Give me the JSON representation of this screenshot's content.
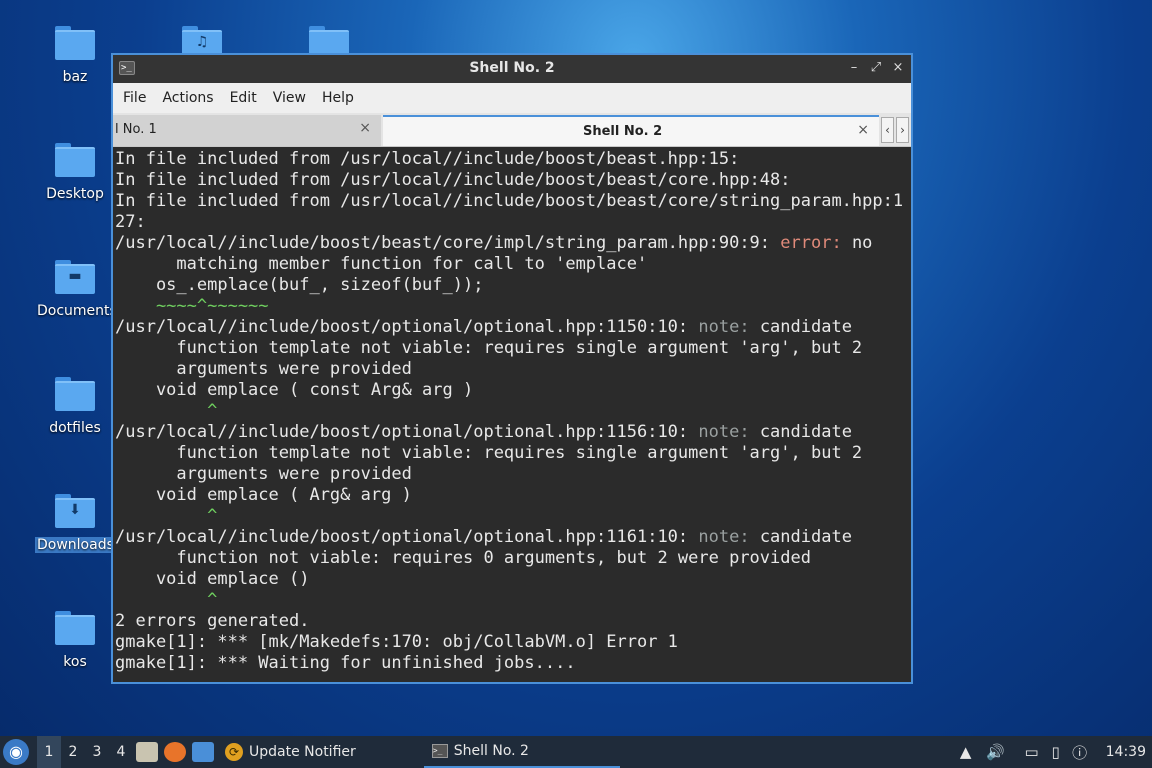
{
  "desktop": {
    "icons": [
      {
        "label": "baz"
      },
      {
        "label": "Desktop"
      },
      {
        "label": "Documents"
      },
      {
        "label": "dotfiles"
      },
      {
        "label": "Downloads"
      },
      {
        "label": "kos"
      }
    ]
  },
  "window": {
    "title": "Shell No. 2",
    "menu": [
      "File",
      "Actions",
      "Edit",
      "View",
      "Help"
    ],
    "tabs": [
      {
        "label": "l No. 1",
        "close": "×"
      },
      {
        "label": "Shell No. 2",
        "close": "×"
      }
    ],
    "controls": {
      "minimize": "–",
      "maximize": "⤢",
      "close": "×"
    },
    "terminal_lines": [
      "In file included from /usr/local//include/boost/beast.hpp:15:",
      "In file included from /usr/local//include/boost/beast/core.hpp:48:",
      "In file included from /usr/local//include/boost/beast/core/string_param.hpp:1",
      "27:",
      "/usr/local//include/boost/beast/core/impl/string_param.hpp:90:9: ",
      "error:",
      " no",
      "      matching member function for call to 'emplace'",
      "    os_.emplace(buf_, sizeof(buf_));",
      "    ~~~~^~~~~~~",
      "/usr/local//include/boost/optional/optional.hpp:1150:10: ",
      "note:",
      " candidate",
      "      function template not viable: requires single argument 'arg', but 2",
      "      arguments were provided",
      "    void emplace ( const Arg& arg )",
      "         ^",
      "/usr/local//include/boost/optional/optional.hpp:1156:10: ",
      "note:",
      " candidate",
      "      function template not viable: requires single argument 'arg', but 2",
      "      arguments were provided",
      "    void emplace ( Arg& arg )",
      "         ^",
      "/usr/local//include/boost/optional/optional.hpp:1161:10: ",
      "note:",
      " candidate",
      "      function not viable: requires 0 arguments, but 2 were provided",
      "    void emplace ()",
      "         ^",
      "2 errors generated.",
      "gmake[1]: *** [mk/Makedefs:170: obj/CollabVM.o] Error 1",
      "gmake[1]: *** Waiting for unfinished jobs...."
    ]
  },
  "taskbar": {
    "desktops": [
      "1",
      "2",
      "3",
      "4"
    ],
    "tasks": [
      {
        "label": "Update Notifier"
      },
      {
        "label": "Shell No. 2"
      }
    ],
    "clock": "14:39"
  },
  "colors": {
    "accent": "#4a90d9",
    "error": "#e08a7a",
    "note": "#9aa0a0",
    "caret": "#6fcf5f"
  }
}
